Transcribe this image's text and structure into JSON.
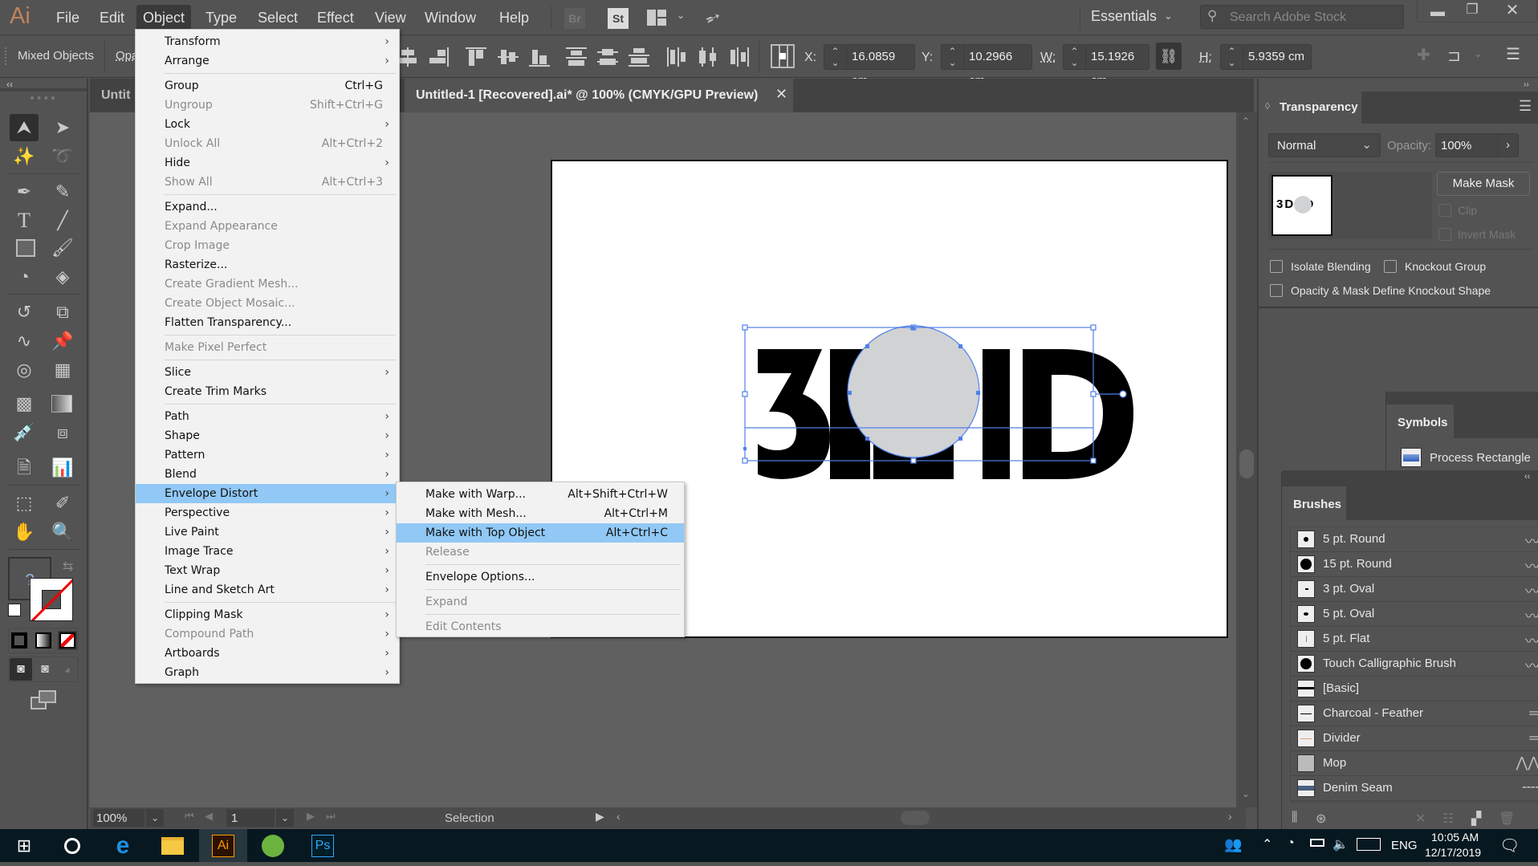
{
  "app": {
    "logo": "Ai"
  },
  "menubar": {
    "items": [
      "File",
      "Edit",
      "Object",
      "Type",
      "Select",
      "Effect",
      "View",
      "Window",
      "Help"
    ],
    "active": "Object",
    "bridge": "Br",
    "stock": "St",
    "workspace": "Essentials",
    "search_placeholder": "Search Adobe Stock"
  },
  "controlbar": {
    "selection_type": "Mixed Objects",
    "opacity_label": "Opa",
    "x_label": "X:",
    "x_value": "16.0859 cm",
    "y_label": "Y:",
    "y_value": "10.2966 cm",
    "w_label": "W:",
    "w_value": "15.1926 cm",
    "h_label": "H:",
    "h_value": "5.9359 cm"
  },
  "document": {
    "tab_partial": "Untit",
    "tab_title": "Untitled-1 [Recovered].ai* @ 100% (CMYK/GPU Preview)",
    "artwork_text": "3DRUID"
  },
  "object_menu": {
    "items": [
      {
        "label": "Transform",
        "submenu": true
      },
      {
        "label": "Arrange",
        "submenu": true
      },
      {
        "sep": true
      },
      {
        "label": "Group",
        "shortcut": "Ctrl+G"
      },
      {
        "label": "Ungroup",
        "shortcut": "Shift+Ctrl+G",
        "disabled": true
      },
      {
        "label": "Lock",
        "submenu": true
      },
      {
        "label": "Unlock All",
        "shortcut": "Alt+Ctrl+2",
        "disabled": true
      },
      {
        "label": "Hide",
        "submenu": true
      },
      {
        "label": "Show All",
        "shortcut": "Alt+Ctrl+3",
        "disabled": true
      },
      {
        "sep": true
      },
      {
        "label": "Expand..."
      },
      {
        "label": "Expand Appearance",
        "disabled": true
      },
      {
        "label": "Crop Image",
        "disabled": true
      },
      {
        "label": "Rasterize..."
      },
      {
        "label": "Create Gradient Mesh...",
        "disabled": true
      },
      {
        "label": "Create Object Mosaic...",
        "disabled": true
      },
      {
        "label": "Flatten Transparency..."
      },
      {
        "sep": true
      },
      {
        "label": "Make Pixel Perfect",
        "disabled": true
      },
      {
        "sep": true
      },
      {
        "label": "Slice",
        "submenu": true
      },
      {
        "label": "Create Trim Marks"
      },
      {
        "sep": true
      },
      {
        "label": "Path",
        "submenu": true
      },
      {
        "label": "Shape",
        "submenu": true
      },
      {
        "label": "Pattern",
        "submenu": true
      },
      {
        "label": "Blend",
        "submenu": true
      },
      {
        "label": "Envelope Distort",
        "submenu": true,
        "highlighted": true
      },
      {
        "label": "Perspective",
        "submenu": true
      },
      {
        "label": "Live Paint",
        "submenu": true
      },
      {
        "label": "Image Trace",
        "submenu": true
      },
      {
        "label": "Text Wrap",
        "submenu": true
      },
      {
        "label": "Line and Sketch Art",
        "submenu": true
      },
      {
        "sep": true
      },
      {
        "label": "Clipping Mask",
        "submenu": true
      },
      {
        "label": "Compound Path",
        "submenu": true,
        "disabled": true
      },
      {
        "label": "Artboards",
        "submenu": true
      },
      {
        "label": "Graph",
        "submenu": true
      }
    ]
  },
  "envelope_submenu": {
    "items": [
      {
        "label": "Make with Warp...",
        "shortcut": "Alt+Shift+Ctrl+W"
      },
      {
        "label": "Make with Mesh...",
        "shortcut": "Alt+Ctrl+M"
      },
      {
        "label": "Make with Top Object",
        "shortcut": "Alt+Ctrl+C",
        "highlighted": true
      },
      {
        "label": "Release",
        "disabled": true
      },
      {
        "sep": true
      },
      {
        "label": "Envelope Options..."
      },
      {
        "sep": true
      },
      {
        "label": "Expand",
        "disabled": true
      },
      {
        "sep": true
      },
      {
        "label": "Edit Contents",
        "disabled": true
      }
    ]
  },
  "transparency": {
    "title": "Transparency",
    "blend_mode": "Normal",
    "opacity_label": "Opacity:",
    "opacity_value": "100%",
    "make_mask": "Make Mask",
    "clip": "Clip",
    "invert_mask": "Invert Mask",
    "isolate_blending": "Isolate Blending",
    "knockout_group": "Knockout Group",
    "opacity_mask_knockout": "Opacity & Mask Define Knockout Shape",
    "thumb_text": "3D ID"
  },
  "symbols": {
    "title": "Symbols",
    "item": "Process Rectangle"
  },
  "brushes": {
    "title": "Brushes",
    "items": [
      "5 pt. Round",
      "15 pt. Round",
      "3 pt. Oval",
      "5 pt. Oval",
      "5 pt. Flat",
      "Touch Calligraphic Brush",
      "[Basic]",
      "Charcoal - Feather",
      "Divider",
      "Mop",
      "Denim Seam"
    ]
  },
  "statusbar": {
    "zoom": "100%",
    "artboard": "1",
    "tool": "Selection"
  },
  "taskbar": {
    "time": "10:05 AM",
    "date": "12/17/2019",
    "lang": "ENG",
    "ai": "Ai",
    "ps": "Ps"
  },
  "colors": {
    "accent_highlight": "#91c8f6",
    "selection_blue": "#4f7fe8",
    "ai_orange": "#ff9a00"
  }
}
